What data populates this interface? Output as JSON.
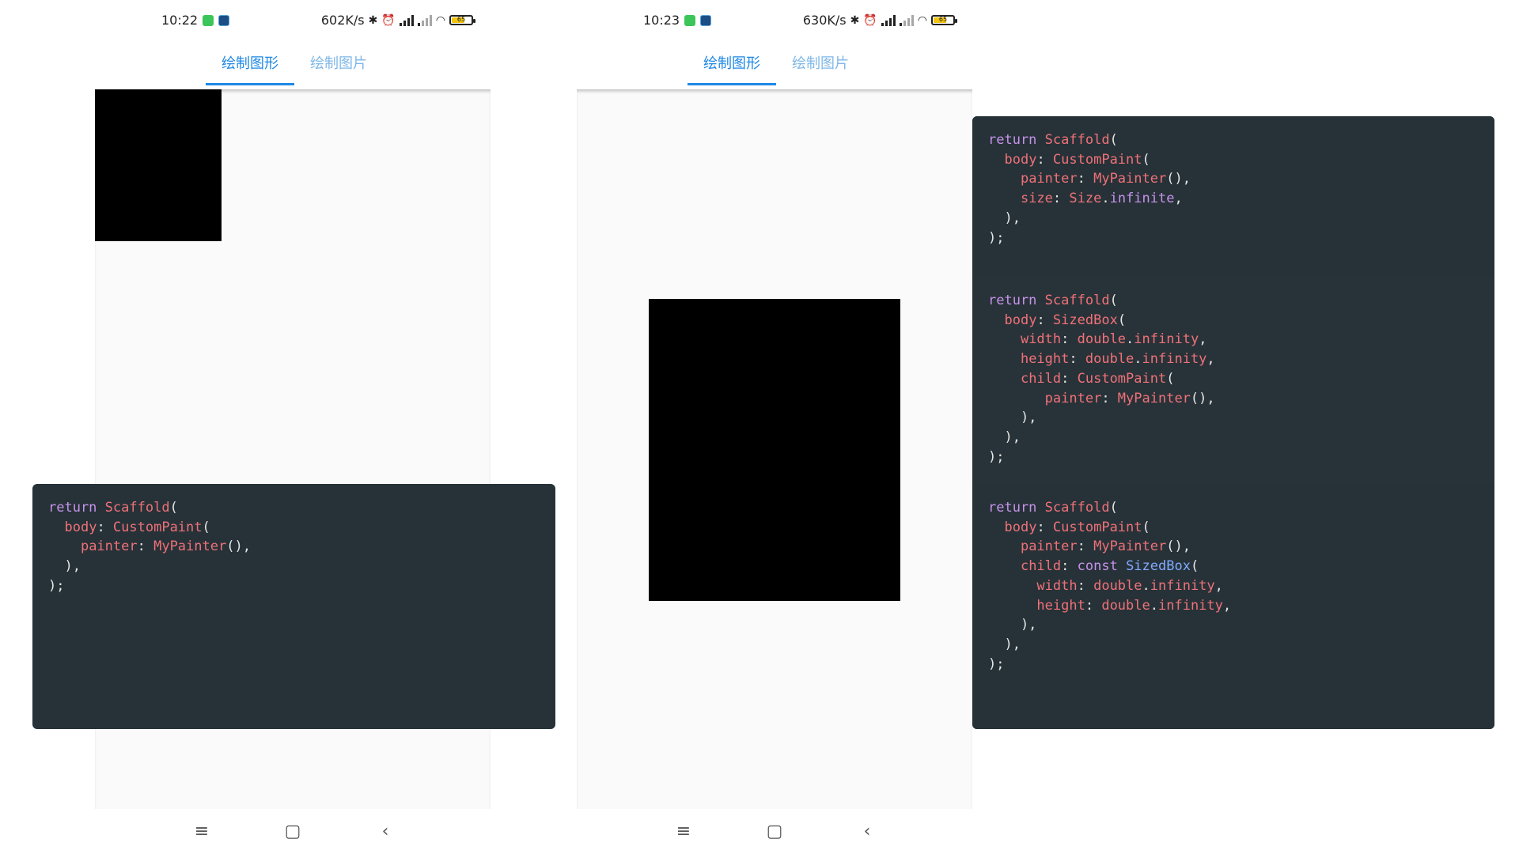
{
  "phones": [
    {
      "status": {
        "time": "10:22",
        "speed": "602K/s",
        "battery": "65"
      },
      "tabs": [
        "绘制图形",
        "绘制图片"
      ],
      "active_tab": 0
    },
    {
      "status": {
        "time": "10:23",
        "speed": "630K/s",
        "battery": "65"
      },
      "tabs": [
        "绘制图形",
        "绘制图片"
      ],
      "active_tab": 0
    }
  ],
  "nav": {
    "menu": "≡",
    "home": "▢",
    "back": "‹"
  },
  "code_left": [
    [
      [
        "kw",
        "return"
      ],
      [
        "tx",
        " "
      ],
      [
        "cls",
        "Scaffold"
      ],
      [
        "tx",
        "("
      ]
    ],
    [
      [
        "tx",
        "  "
      ],
      [
        "cls",
        "body"
      ],
      [
        "tx",
        ": "
      ],
      [
        "cls",
        "CustomPaint"
      ],
      [
        "tx",
        "("
      ]
    ],
    [
      [
        "tx",
        "    "
      ],
      [
        "cls",
        "painter"
      ],
      [
        "tx",
        ": "
      ],
      [
        "cls",
        "MyPainter"
      ],
      [
        "tx",
        "(),"
      ]
    ],
    [
      [
        "tx",
        "  ),"
      ]
    ],
    [
      [
        "tx",
        ");"
      ]
    ]
  ],
  "code_right": [
    [
      [
        [
          "kw",
          "return"
        ],
        [
          "tx",
          " "
        ],
        [
          "cls",
          "Scaffold"
        ],
        [
          "tx",
          "("
        ]
      ],
      [
        [
          "tx",
          "  "
        ],
        [
          "cls",
          "body"
        ],
        [
          "tx",
          ": "
        ],
        [
          "cls",
          "CustomPaint"
        ],
        [
          "tx",
          "("
        ]
      ],
      [
        [
          "tx",
          "    "
        ],
        [
          "cls",
          "painter"
        ],
        [
          "tx",
          ": "
        ],
        [
          "cls",
          "MyPainter"
        ],
        [
          "tx",
          "(),"
        ]
      ],
      [
        [
          "tx",
          "    "
        ],
        [
          "cls",
          "size"
        ],
        [
          "tx",
          ": "
        ],
        [
          "cls",
          "Size"
        ],
        [
          "tx",
          "."
        ],
        [
          "kw",
          "infinite"
        ],
        [
          "tx",
          ","
        ]
      ],
      [
        [
          "tx",
          "  ),"
        ]
      ],
      [
        [
          "tx",
          ");"
        ]
      ]
    ],
    [
      [
        [
          "kw",
          "return"
        ],
        [
          "tx",
          " "
        ],
        [
          "cls",
          "Scaffold"
        ],
        [
          "tx",
          "("
        ]
      ],
      [
        [
          "tx",
          "  "
        ],
        [
          "cls",
          "body"
        ],
        [
          "tx",
          ": "
        ],
        [
          "cls",
          "SizedBox"
        ],
        [
          "tx",
          "("
        ]
      ],
      [
        [
          "tx",
          "    "
        ],
        [
          "cls",
          "width"
        ],
        [
          "tx",
          ": "
        ],
        [
          "cls",
          "double"
        ],
        [
          "tx",
          "."
        ],
        [
          "cls",
          "infinity"
        ],
        [
          "tx",
          ","
        ]
      ],
      [
        [
          "tx",
          "    "
        ],
        [
          "cls",
          "height"
        ],
        [
          "tx",
          ": "
        ],
        [
          "cls",
          "double"
        ],
        [
          "tx",
          "."
        ],
        [
          "cls",
          "infinity"
        ],
        [
          "tx",
          ","
        ]
      ],
      [
        [
          "tx",
          "    "
        ],
        [
          "cls",
          "child"
        ],
        [
          "tx",
          ": "
        ],
        [
          "cls",
          "CustomPaint"
        ],
        [
          "tx",
          "("
        ]
      ],
      [
        [
          "tx",
          "       "
        ],
        [
          "cls",
          "painter"
        ],
        [
          "tx",
          ": "
        ],
        [
          "cls",
          "MyPainter"
        ],
        [
          "tx",
          "(),"
        ]
      ],
      [
        [
          "tx",
          "    ),"
        ]
      ],
      [
        [
          "tx",
          "  ),"
        ]
      ],
      [
        [
          "tx",
          ");"
        ]
      ]
    ],
    [
      [
        [
          "kw",
          "return"
        ],
        [
          "tx",
          " "
        ],
        [
          "cls",
          "Scaffold"
        ],
        [
          "tx",
          "("
        ]
      ],
      [
        [
          "tx",
          "  "
        ],
        [
          "cls",
          "body"
        ],
        [
          "tx",
          ": "
        ],
        [
          "cls",
          "CustomPaint"
        ],
        [
          "tx",
          "("
        ]
      ],
      [
        [
          "tx",
          "    "
        ],
        [
          "cls",
          "painter"
        ],
        [
          "tx",
          ": "
        ],
        [
          "cls",
          "MyPainter"
        ],
        [
          "tx",
          "(),"
        ]
      ],
      [
        [
          "tx",
          "    "
        ],
        [
          "cls",
          "child"
        ],
        [
          "tx",
          ": "
        ],
        [
          "kw",
          "const"
        ],
        [
          "tx",
          " "
        ],
        [
          "at",
          "SizedBox"
        ],
        [
          "tx",
          "("
        ]
      ],
      [
        [
          "tx",
          "      "
        ],
        [
          "cls",
          "width"
        ],
        [
          "tx",
          ": "
        ],
        [
          "cls",
          "double"
        ],
        [
          "tx",
          "."
        ],
        [
          "cls",
          "infinity"
        ],
        [
          "tx",
          ","
        ]
      ],
      [
        [
          "tx",
          "      "
        ],
        [
          "cls",
          "height"
        ],
        [
          "tx",
          ": "
        ],
        [
          "cls",
          "double"
        ],
        [
          "tx",
          "."
        ],
        [
          "cls",
          "infinity"
        ],
        [
          "tx",
          ","
        ]
      ],
      [
        [
          "tx",
          "    ),"
        ]
      ],
      [
        [
          "tx",
          "  ),"
        ]
      ],
      [
        [
          "tx",
          ");"
        ]
      ]
    ]
  ],
  "colors": {
    "code_bg": "#263238",
    "keyword": "#c792ea",
    "identifier": "#f07178",
    "tab_active": "#1e88e5"
  }
}
